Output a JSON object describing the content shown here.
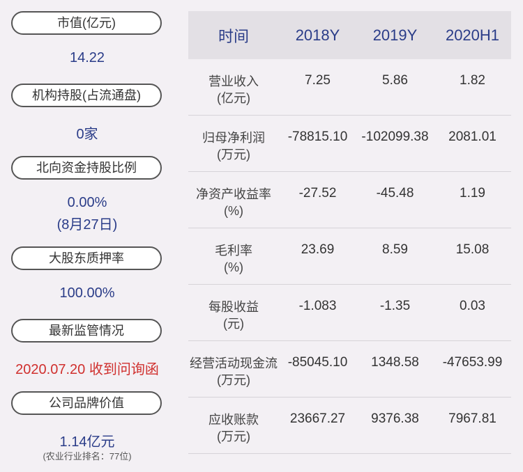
{
  "left": {
    "items": [
      {
        "label": "市值(亿元)",
        "value": "14.22"
      },
      {
        "label": "机构持股(占流通盘)",
        "value": "0家"
      },
      {
        "label": "北向资金持股比例",
        "value": "0.00%",
        "value2": "(8月27日)"
      },
      {
        "label": "大股东质押率",
        "value": "100.00%"
      },
      {
        "label": "最新监管情况",
        "value": "2020.07.20 收到问询函"
      },
      {
        "label": "公司品牌价值",
        "value": "1.14亿元",
        "note": "(农业行业排名：77位)"
      }
    ]
  },
  "table": {
    "headers": [
      "时间",
      "2018Y",
      "2019Y",
      "2020H1"
    ],
    "rows": [
      {
        "name": "营业收入",
        "unit": "(亿元)",
        "values": [
          "7.25",
          "5.86",
          "1.82"
        ]
      },
      {
        "name": "归母净利润",
        "unit": "(万元)",
        "values": [
          "-78815.10",
          "-102099.38",
          "2081.01"
        ]
      },
      {
        "name": "净资产收益率",
        "unit": "(%)",
        "values": [
          "-27.52",
          "-45.48",
          "1.19"
        ]
      },
      {
        "name": "毛利率",
        "unit": "(%)",
        "values": [
          "23.69",
          "8.59",
          "15.08"
        ]
      },
      {
        "name": "每股收益",
        "unit": "(元)",
        "values": [
          "-1.083",
          "-1.35",
          "0.03"
        ]
      },
      {
        "name": "经营活动现金流",
        "unit": "(万元)",
        "values": [
          "-85045.10",
          "1348.58",
          "-47653.99"
        ]
      },
      {
        "name": "应收账款",
        "unit": "(万元)",
        "values": [
          "23667.27",
          "9376.38",
          "7967.81"
        ]
      }
    ]
  }
}
